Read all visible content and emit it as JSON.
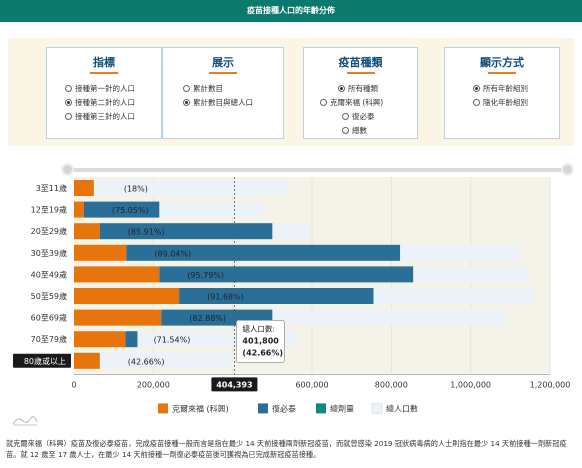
{
  "header": {
    "title": "疫苗接種人口的年齡分佈"
  },
  "controls": {
    "indicator": {
      "title": "指標",
      "options": [
        "接種第一針的人口",
        "接種第二針的人口",
        "接種第三針的人口"
      ],
      "selected": 1
    },
    "display": {
      "title": "展示",
      "options": [
        "累計數目",
        "累計數目與總人口"
      ],
      "selected": 1
    },
    "vaccine": {
      "title": "疫苗種類",
      "options": [
        "所有種類",
        "克爾來福 (科興)",
        "復必泰",
        "總數"
      ],
      "selected": 0
    },
    "mode": {
      "title": "顯示方式",
      "options": [
        "所有年齡組別",
        "隨化年齡組別"
      ],
      "selected": 0
    }
  },
  "chart_data": {
    "type": "bar",
    "orientation": "horizontal",
    "stacked": true,
    "categories": [
      "3至11歲",
      "12至19歲",
      "20至29歲",
      "30至39歲",
      "40至49歲",
      "50至59歲",
      "60至69歲",
      "70至79歲",
      "80歲或以上"
    ],
    "series": [
      {
        "name": "克爾來福 (科興)",
        "color": "#e8740c",
        "values": [
          50000,
          25000,
          65000,
          132000,
          215000,
          265000,
          220000,
          130000,
          65000
        ]
      },
      {
        "name": "復必泰",
        "color": "#2a6f97",
        "values": [
          0,
          190000,
          435000,
          690000,
          640000,
          490000,
          280000,
          30000,
          0
        ]
      },
      {
        "name": "總劑量",
        "color": "#0e8a7a",
        "values": [
          0,
          0,
          0,
          0,
          0,
          0,
          0,
          0,
          0
        ]
      },
      {
        "name": "總人口數",
        "color": "#edf1f8",
        "values": [
          535000,
          482000,
          595000,
          1125000,
          1150000,
          1160000,
          1090000,
          565000,
          401800
        ]
      }
    ],
    "percent_labels": [
      "(18%)",
      "(75.05%)",
      "(85.91%)",
      "(89.04%)",
      "(95.79%)",
      "(91.68%)",
      "(82.88%)",
      "(71.54%)",
      "(42.66%)"
    ],
    "xlim": [
      0,
      1200000
    ],
    "x_ticks": [
      "0",
      "200,000",
      "400,000",
      "600,000",
      "800,000",
      "1,000,000",
      "1,200,000"
    ],
    "highlight_category": "80歲或以上",
    "crosshair_value": 404393,
    "crosshair_label": "404,393",
    "tooltip": {
      "title": "總人口數:",
      "value": "401,800",
      "percent": "(42.66%)"
    },
    "legend_position": "bottom"
  },
  "footnote": "就克爾來福（科興）疫苗及復必泰疫苗，完成疫苗接種一般而言是指在最少 14 天前接種兩劑新冠疫苗，而就曾感染 2019 冠狀病毒病的人士則指在最少 14 天前接種一劑新冠疫苗。就 12 歲至 17 歲人士，在最少 14 天前接種一劑復必泰疫苗後可獲視為已完成新冠疫苗接種。"
}
